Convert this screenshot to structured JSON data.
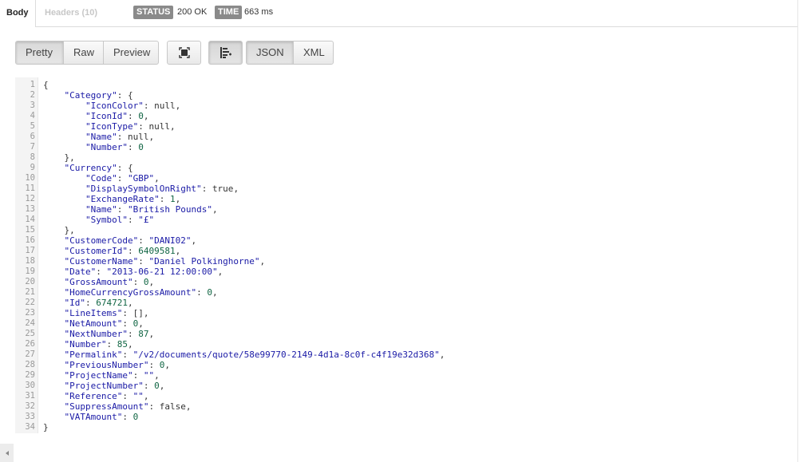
{
  "tabs": {
    "body": "Body",
    "headers": "Headers (10)"
  },
  "status": {
    "label": "STATUS",
    "value": "200 OK"
  },
  "time": {
    "label": "TIME",
    "value": "663 ms"
  },
  "view_modes": [
    "Pretty",
    "Raw",
    "Preview"
  ],
  "formats": [
    "JSON",
    "XML"
  ],
  "icons": {
    "fullscreen": "fullscreen-icon",
    "wrap": "wrap-lines-icon",
    "scroll_left": "scroll-left-arrow-icon"
  },
  "colors": {
    "key": "#1a1aa6",
    "string": "#1a1aa6",
    "number": "#116644",
    "badge": "#8a8a8a"
  },
  "code_lines": [
    {
      "n": "1",
      "t": [
        [
          "p",
          "{"
        ]
      ]
    },
    {
      "n": "2",
      "t": [
        [
          "p",
          "    "
        ],
        [
          "k",
          "\"Category\""
        ],
        [
          "p",
          ": {"
        ]
      ]
    },
    {
      "n": "3",
      "t": [
        [
          "p",
          "        "
        ],
        [
          "k",
          "\"IconColor\""
        ],
        [
          "p",
          ": "
        ],
        [
          "kw",
          "null"
        ],
        [
          "p",
          ","
        ]
      ]
    },
    {
      "n": "4",
      "t": [
        [
          "p",
          "        "
        ],
        [
          "k",
          "\"IconId\""
        ],
        [
          "p",
          ": "
        ],
        [
          "n",
          "0"
        ],
        [
          "p",
          ","
        ]
      ]
    },
    {
      "n": "5",
      "t": [
        [
          "p",
          "        "
        ],
        [
          "k",
          "\"IconType\""
        ],
        [
          "p",
          ": "
        ],
        [
          "kw",
          "null"
        ],
        [
          "p",
          ","
        ]
      ]
    },
    {
      "n": "6",
      "t": [
        [
          "p",
          "        "
        ],
        [
          "k",
          "\"Name\""
        ],
        [
          "p",
          ": "
        ],
        [
          "kw",
          "null"
        ],
        [
          "p",
          ","
        ]
      ]
    },
    {
      "n": "7",
      "t": [
        [
          "p",
          "        "
        ],
        [
          "k",
          "\"Number\""
        ],
        [
          "p",
          ": "
        ],
        [
          "n",
          "0"
        ]
      ]
    },
    {
      "n": "8",
      "t": [
        [
          "p",
          "    },"
        ]
      ]
    },
    {
      "n": "9",
      "t": [
        [
          "p",
          "    "
        ],
        [
          "k",
          "\"Currency\""
        ],
        [
          "p",
          ": {"
        ]
      ]
    },
    {
      "n": "10",
      "t": [
        [
          "p",
          "        "
        ],
        [
          "k",
          "\"Code\""
        ],
        [
          "p",
          ": "
        ],
        [
          "s",
          "\"GBP\""
        ],
        [
          "p",
          ","
        ]
      ]
    },
    {
      "n": "11",
      "t": [
        [
          "p",
          "        "
        ],
        [
          "k",
          "\"DisplaySymbolOnRight\""
        ],
        [
          "p",
          ": "
        ],
        [
          "kw",
          "true"
        ],
        [
          "p",
          ","
        ]
      ]
    },
    {
      "n": "12",
      "t": [
        [
          "p",
          "        "
        ],
        [
          "k",
          "\"ExchangeRate\""
        ],
        [
          "p",
          ": "
        ],
        [
          "n",
          "1"
        ],
        [
          "p",
          ","
        ]
      ]
    },
    {
      "n": "13",
      "t": [
        [
          "p",
          "        "
        ],
        [
          "k",
          "\"Name\""
        ],
        [
          "p",
          ": "
        ],
        [
          "s",
          "\"British Pounds\""
        ],
        [
          "p",
          ","
        ]
      ]
    },
    {
      "n": "14",
      "t": [
        [
          "p",
          "        "
        ],
        [
          "k",
          "\"Symbol\""
        ],
        [
          "p",
          ": "
        ],
        [
          "s",
          "\"£\""
        ]
      ]
    },
    {
      "n": "15",
      "t": [
        [
          "p",
          "    },"
        ]
      ]
    },
    {
      "n": "16",
      "t": [
        [
          "p",
          "    "
        ],
        [
          "k",
          "\"CustomerCode\""
        ],
        [
          "p",
          ": "
        ],
        [
          "s",
          "\"DANI02\""
        ],
        [
          "p",
          ","
        ]
      ]
    },
    {
      "n": "17",
      "t": [
        [
          "p",
          "    "
        ],
        [
          "k",
          "\"CustomerId\""
        ],
        [
          "p",
          ": "
        ],
        [
          "n",
          "6409581"
        ],
        [
          "p",
          ","
        ]
      ]
    },
    {
      "n": "18",
      "t": [
        [
          "p",
          "    "
        ],
        [
          "k",
          "\"CustomerName\""
        ],
        [
          "p",
          ": "
        ],
        [
          "s",
          "\"Daniel Polkinghorne\""
        ],
        [
          "p",
          ","
        ]
      ]
    },
    {
      "n": "19",
      "t": [
        [
          "p",
          "    "
        ],
        [
          "k",
          "\"Date\""
        ],
        [
          "p",
          ": "
        ],
        [
          "s",
          "\"2013-06-21 12:00:00\""
        ],
        [
          "p",
          ","
        ]
      ]
    },
    {
      "n": "20",
      "t": [
        [
          "p",
          "    "
        ],
        [
          "k",
          "\"GrossAmount\""
        ],
        [
          "p",
          ": "
        ],
        [
          "n",
          "0"
        ],
        [
          "p",
          ","
        ]
      ]
    },
    {
      "n": "21",
      "t": [
        [
          "p",
          "    "
        ],
        [
          "k",
          "\"HomeCurrencyGrossAmount\""
        ],
        [
          "p",
          ": "
        ],
        [
          "n",
          "0"
        ],
        [
          "p",
          ","
        ]
      ]
    },
    {
      "n": "22",
      "t": [
        [
          "p",
          "    "
        ],
        [
          "k",
          "\"Id\""
        ],
        [
          "p",
          ": "
        ],
        [
          "n",
          "674721"
        ],
        [
          "p",
          ","
        ]
      ]
    },
    {
      "n": "23",
      "t": [
        [
          "p",
          "    "
        ],
        [
          "k",
          "\"LineItems\""
        ],
        [
          "p",
          ": [],"
        ]
      ]
    },
    {
      "n": "24",
      "t": [
        [
          "p",
          "    "
        ],
        [
          "k",
          "\"NetAmount\""
        ],
        [
          "p",
          ": "
        ],
        [
          "n",
          "0"
        ],
        [
          "p",
          ","
        ]
      ]
    },
    {
      "n": "25",
      "t": [
        [
          "p",
          "    "
        ],
        [
          "k",
          "\"NextNumber\""
        ],
        [
          "p",
          ": "
        ],
        [
          "n",
          "87"
        ],
        [
          "p",
          ","
        ]
      ]
    },
    {
      "n": "26",
      "t": [
        [
          "p",
          "    "
        ],
        [
          "k",
          "\"Number\""
        ],
        [
          "p",
          ": "
        ],
        [
          "n",
          "85"
        ],
        [
          "p",
          ","
        ]
      ]
    },
    {
      "n": "27",
      "t": [
        [
          "p",
          "    "
        ],
        [
          "k",
          "\"Permalink\""
        ],
        [
          "p",
          ": "
        ],
        [
          "s",
          "\"/v2/documents/quote/58e99770-2149-4d1a-8c0f-c4f19e32d368\""
        ],
        [
          "p",
          ","
        ]
      ]
    },
    {
      "n": "28",
      "t": [
        [
          "p",
          "    "
        ],
        [
          "k",
          "\"PreviousNumber\""
        ],
        [
          "p",
          ": "
        ],
        [
          "n",
          "0"
        ],
        [
          "p",
          ","
        ]
      ]
    },
    {
      "n": "29",
      "t": [
        [
          "p",
          "    "
        ],
        [
          "k",
          "\"ProjectName\""
        ],
        [
          "p",
          ": "
        ],
        [
          "s",
          "\"\""
        ],
        [
          "p",
          ","
        ]
      ]
    },
    {
      "n": "30",
      "t": [
        [
          "p",
          "    "
        ],
        [
          "k",
          "\"ProjectNumber\""
        ],
        [
          "p",
          ": "
        ],
        [
          "n",
          "0"
        ],
        [
          "p",
          ","
        ]
      ]
    },
    {
      "n": "31",
      "t": [
        [
          "p",
          "    "
        ],
        [
          "k",
          "\"Reference\""
        ],
        [
          "p",
          ": "
        ],
        [
          "s",
          "\"\""
        ],
        [
          "p",
          ","
        ]
      ]
    },
    {
      "n": "32",
      "t": [
        [
          "p",
          "    "
        ],
        [
          "k",
          "\"SuppressAmount\""
        ],
        [
          "p",
          ": "
        ],
        [
          "kw",
          "false"
        ],
        [
          "p",
          ","
        ]
      ]
    },
    {
      "n": "33",
      "t": [
        [
          "p",
          "    "
        ],
        [
          "k",
          "\"VATAmount\""
        ],
        [
          "p",
          ": "
        ],
        [
          "n",
          "0"
        ]
      ]
    },
    {
      "n": "34",
      "t": [
        [
          "p",
          "}"
        ]
      ]
    }
  ]
}
